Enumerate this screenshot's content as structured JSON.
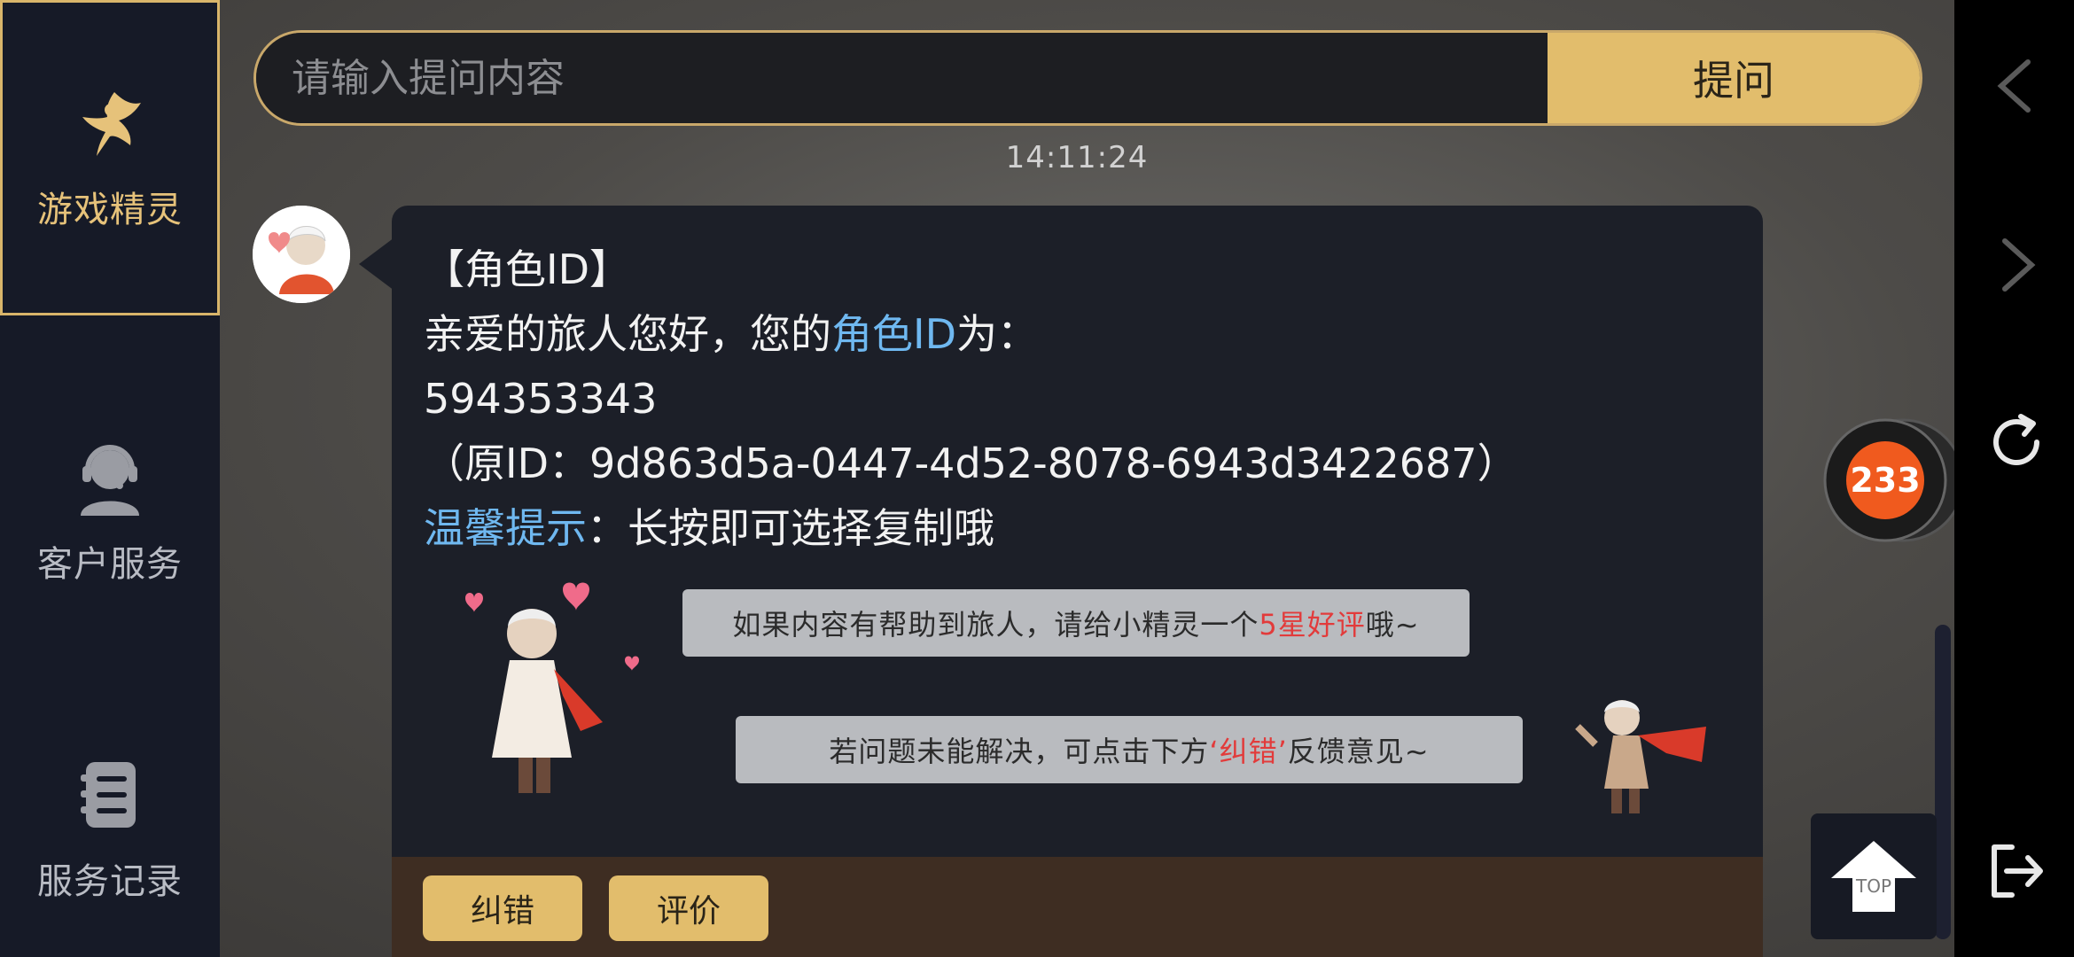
{
  "sidebar": {
    "items": [
      {
        "label": "游戏精灵",
        "icon": "fairy-icon",
        "active": true
      },
      {
        "label": "客户服务",
        "icon": "headset-agent-icon",
        "active": false
      },
      {
        "label": "服务记录",
        "icon": "records-list-icon",
        "active": false
      }
    ]
  },
  "search": {
    "placeholder": "请输入提问内容",
    "value": "",
    "submit_label": "提问"
  },
  "timestamp": "14:11:24",
  "message": {
    "title": "【角色ID】",
    "greeting_prefix": "亲爱的旅人您好，您的",
    "greeting_highlight": "角色ID",
    "greeting_suffix": "为：",
    "role_id": "594353343",
    "original_id_line": "（原ID：9d863d5a-0447-4d52-8078-6943d3422687）",
    "tip_label": "温馨提示",
    "tip_text": "：长按即可选择复制哦",
    "helpful_prefix": "如果内容有帮助到旅人，请给小精灵一个",
    "helpful_highlight": "5星好评",
    "helpful_suffix": "哦~",
    "unresolved_prefix": "若问题未能解决，可点击下方",
    "unresolved_highlight": "‘纠错’",
    "unresolved_suffix": "反馈意见~"
  },
  "actions": {
    "correct_label": "纠错",
    "rate_label": "评价"
  },
  "floating_badge": "233",
  "top_button_label": "TOP",
  "colors": {
    "accent_gold": "#e2bd6c",
    "highlight_blue": "#6fb8f0",
    "highlight_red": "#e23b3b",
    "sidebar_bg": "#161a27",
    "bubble_bg": "#1c1f28"
  }
}
